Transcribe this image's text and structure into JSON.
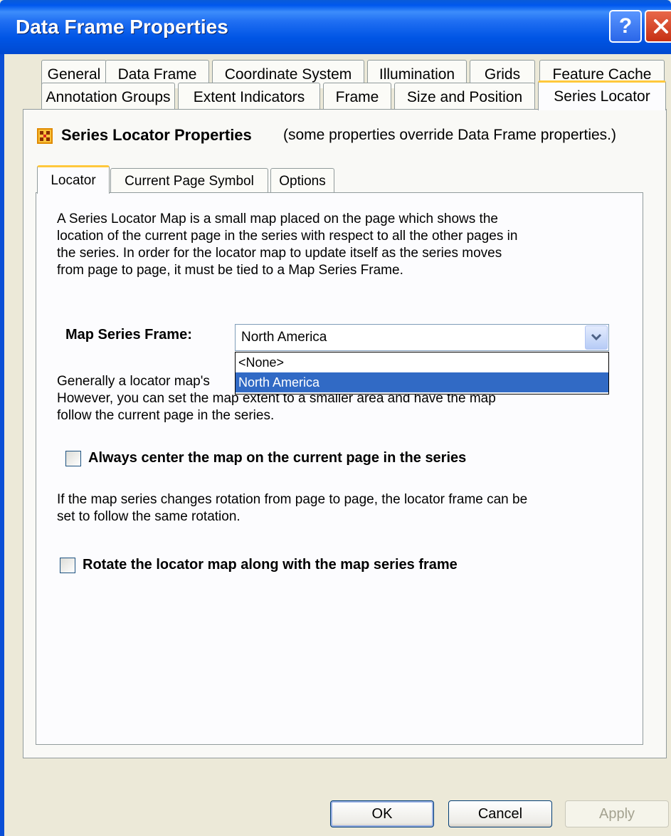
{
  "window": {
    "title": "Data Frame Properties",
    "help_glyph": "?"
  },
  "tabs_row1": [
    {
      "label": "General"
    },
    {
      "label": "Data Frame"
    },
    {
      "label": "Coordinate System"
    },
    {
      "label": "Illumination"
    },
    {
      "label": "Grids"
    },
    {
      "label": "Feature Cache"
    }
  ],
  "tabs_row2": [
    {
      "label": "Annotation Groups"
    },
    {
      "label": "Extent Indicators"
    },
    {
      "label": "Frame"
    },
    {
      "label": "Size and Position"
    },
    {
      "label": "Series Locator"
    }
  ],
  "header": {
    "icon": "series-locator-icon",
    "title": "Series Locator Properties",
    "note": "(some properties override Data Frame properties.)"
  },
  "inner_tabs": [
    {
      "label": "Locator"
    },
    {
      "label": "Current Page Symbol"
    },
    {
      "label": "Options"
    }
  ],
  "locator": {
    "description_lines": [
      "A Series Locator Map is a small map placed on the page which shows the",
      "location of the current page in the series with respect to all the other pages in",
      "the series.  In order for the locator map to update itself as the series moves",
      "from page to page, it must be tied to a Map Series Frame."
    ],
    "map_series_label": "Map Series Frame:",
    "map_series_value": "North America",
    "dropdown_options": [
      "<None>",
      "North America"
    ],
    "extent_lines": [
      "Generally a locator map's",
      "However, you can set the map extent to a smaller area and have the map",
      "follow the current page in the series."
    ],
    "center_checkbox_label": "Always center the map on the current page in the series",
    "rotation_lines": [
      "If the map series changes rotation from page to page, the locator frame can be",
      "set to follow the same rotation."
    ],
    "rotate_checkbox_label": "Rotate the locator map along with the map series frame"
  },
  "buttons": {
    "ok": "OK",
    "cancel": "Cancel",
    "apply": "Apply"
  },
  "colors": {
    "titlebar": "#0055e5",
    "active_tab_accent": "#ffc83c",
    "selection": "#316ac5"
  }
}
